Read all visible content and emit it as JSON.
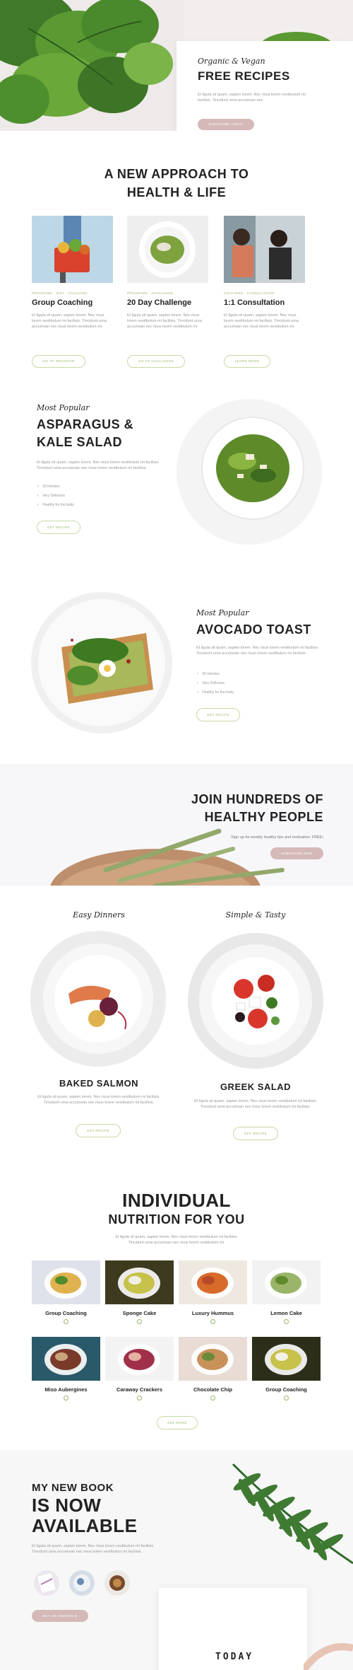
{
  "hero": {
    "script": "Organic & Vegan",
    "title": "FREE RECIPES",
    "text": "Et ligula sit quam, sapien lorem. Nec risus lorem vestibulum mi facilisis. Tincidunt urna accumsan nec.",
    "button": "SUBSCRIBE TODAY"
  },
  "approach": {
    "title_line1": "A NEW APPROACH TO",
    "title_line2": "HEALTH & LIFE",
    "cards": [
      {
        "tags": "PROGRAMS  ·  DIET  ·  COACHING",
        "title": "Group Coaching",
        "text": "Et ligula sit quam, sapien lorem. Nec risus lorem vestibulum mi facilisis. Tincidunt urna accumsan nec risus lorem vestibulum mi.",
        "button": "GO TO PROGRAM"
      },
      {
        "tags": "PROGRAMS  ·  CHALLENGE",
        "title": "20 Day Challenge",
        "text": "Et ligula sit quam, sapien lorem. Nec risus lorem vestibulum mi facilisis. Tincidunt urna accumsan nec risus lorem vestibulum mi.",
        "button": "GO TO CHALLENGE"
      },
      {
        "tags": "COACHING  ·  CONSULTATION",
        "title": "1:1 Consultation",
        "text": "Et ligula sit quam, sapien lorem. Nec risus lorem vestibulum mi facilisis. Tincidunt urna accumsan nec risus lorem vestibulum mi.",
        "button": "LEARN MORE"
      }
    ]
  },
  "asparagus": {
    "script": "Most Popular",
    "title_line1": "ASPARAGUS &",
    "title_line2": "KALE SALAD",
    "text": "Et ligula sit quam, sapien lorem. Nec risus lorem vestibulum mi facilisis. Tincidunt urna accumsan nec risus lorem vestibulum mi facilisis.",
    "checks": [
      "30 minutes",
      "Very Delicious",
      "Healthy for the body"
    ],
    "button": "GET RECIPE"
  },
  "avocado": {
    "script": "Most Popular",
    "title": "AVOCADO TOAST",
    "text": "Et ligula sit quam, sapien lorem. Nec risus lorem vestibulum mi facilisis. Tincidunt urna accumsan nec risus lorem vestibulum mi facilisis.",
    "checks": [
      "30 minutes",
      "Very Delicious",
      "Healthy for the body"
    ],
    "button": "GET RECIPE"
  },
  "join": {
    "title_line1": "JOIN HUNDREDS OF",
    "title_line2": "HEALTHY PEOPLE",
    "text": "Sign up for weekly healthy tips and motivation. FREE!",
    "button": "SUBSCRIBE NOW"
  },
  "dinners": [
    {
      "script": "Easy Dinners",
      "title": "BAKED SALMON",
      "text": "Et ligula sit quam, sapien lorem. Nec risus lorem vestibulum mi facilisis. Tincidunt urna accumsan nec risus lorem vestibulum mi facilisis.",
      "button": "GET RECIPE"
    },
    {
      "script": "Simple & Tasty",
      "title": "GREEK SALAD",
      "text": "Et ligula sit quam, sapien lorem. Nec risus lorem vestibulum mi facilisis. Tincidunt urna accumsan nec risus lorem vestibulum mi facilisis.",
      "button": "GET RECIPE"
    }
  ],
  "nutrition": {
    "title_line1": "INDIVIDUAL",
    "title_line2": "NUTRITION FOR YOU",
    "text": "Et ligula sit quam, sapien lorem. Nec risus lorem vestibulum mi facilisis. Tincidunt urna accumsan nec risus lorem vestibulum mi.",
    "items": [
      "Group Coaching",
      "Sponge Cake",
      "Luxury Hummus",
      "Lemon Cake",
      "Miso Aubergines",
      "Caraway Crackers",
      "Chocolate Chip",
      "Group Coaching"
    ],
    "button": "SEE MORE"
  },
  "book": {
    "kicker": "MY NEW BOOK",
    "title_line1": "IS NOW",
    "title_line2": "AVAILABLE",
    "text": "Et ligula sit quam, sapien lorem. Nec risus lorem vestibulum mi facilisis. Tincidunt urna accumsan nec risus lorem vestibulum mi facilisis.",
    "button": "BUY ON AMAZON  $",
    "cover_text": "TODAY"
  },
  "colors": {
    "accent_green": "#9ab56a",
    "accent_pink": "#d5b9b8"
  }
}
